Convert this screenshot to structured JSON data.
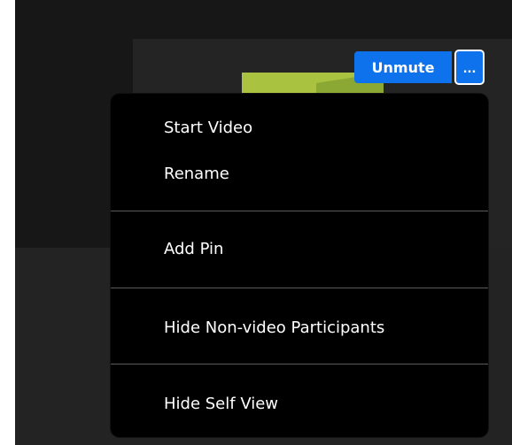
{
  "toolbar": {
    "unmute_label": "Unmute",
    "more_label": "...",
    "more_icon": "ellipsis-icon"
  },
  "menu": {
    "items": [
      {
        "label": "Start Video"
      },
      {
        "label": "Rename"
      },
      {
        "label": "Add Pin"
      },
      {
        "label": "Hide Non-video Participants"
      },
      {
        "label": "Hide Self View"
      }
    ]
  },
  "colors": {
    "accent": "#0e72ed",
    "menu_background": "#000000",
    "menu_text": "#ffffff",
    "divider": "#5a5a5a",
    "app_background": "#1a1a1a"
  }
}
